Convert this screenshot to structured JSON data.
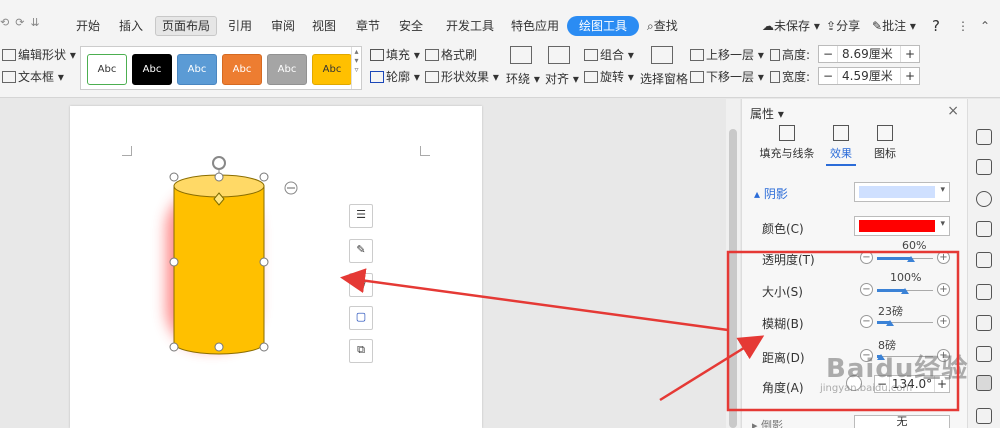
{
  "menubar": {
    "quick_access": [
      "⟲",
      "⟳",
      "⇊"
    ],
    "tabs": [
      "开始",
      "插入",
      "页面布局",
      "引用",
      "审阅",
      "视图",
      "章节",
      "安全",
      "开发工具",
      "特色应用",
      "绘图工具"
    ],
    "search": "查找",
    "unsaved": "未保存",
    "share": "分享",
    "comment": "批注",
    "help": "?"
  },
  "ribbon": {
    "edit_shape": "编辑形状",
    "text_box": "文本框",
    "style_swatches": [
      {
        "label": "Abc",
        "bg": "#ffffff",
        "border": "#4caf50",
        "color": "#333333"
      },
      {
        "label": "Abc",
        "bg": "#000000",
        "border": "#000000",
        "color": "#ffffff"
      },
      {
        "label": "Abc",
        "bg": "#5b9bd5",
        "border": "#4a86c0",
        "color": "#ffffff"
      },
      {
        "label": "Abc",
        "bg": "#ed7d31",
        "border": "#d56a22",
        "color": "#ffffff"
      },
      {
        "label": "Abc",
        "bg": "#a5a5a5",
        "border": "#929292",
        "color": "#ffffff"
      },
      {
        "label": "Abc",
        "bg": "#ffc000",
        "border": "#e0a800",
        "color": "#333333"
      }
    ],
    "fill": "填充",
    "format_painter": "格式刷",
    "outline": "轮廓",
    "shape_effects": "形状效果",
    "wrap": "环绕",
    "align": "对齐",
    "group": "组合",
    "rotate": "旋转",
    "selection_pane": "选择窗格",
    "bring_forward": "上移一层",
    "send_backward": "下移一层",
    "height_label": "高度:",
    "height_value": "8.69厘米",
    "width_label": "宽度:",
    "width_value": "4.59厘米"
  },
  "pane": {
    "title": "属性",
    "tabs": [
      "填充与线条",
      "效果",
      "图标"
    ],
    "section_shadow": "阴影",
    "color_label": "颜色(C)",
    "transparency_label": "透明度(T)",
    "transparency_value": "60%",
    "size_label": "大小(S)",
    "size_value": "100%",
    "blur_label": "模糊(B)",
    "blur_value": "23磅",
    "distance_label": "距离(D)",
    "distance_value": "8磅",
    "angle_label": "角度(A)",
    "angle_value": "134.0°",
    "reflection_label": "倒影",
    "reflection_value": "无",
    "shadow_color": "#ff0000",
    "preset_color": "#cfe0ff"
  },
  "levels": {
    "transparency": 0.6,
    "size": 0.5,
    "blur": 0.23,
    "distance": 0.08
  },
  "colors": {
    "accent": "#2b8cf3",
    "cylinder": "#ffc000",
    "cylinder_top": "#ffd966",
    "arrow": "#e53935"
  },
  "watermark": {
    "brand": "Baidu经验",
    "url": "jingyan.baidu.com"
  }
}
